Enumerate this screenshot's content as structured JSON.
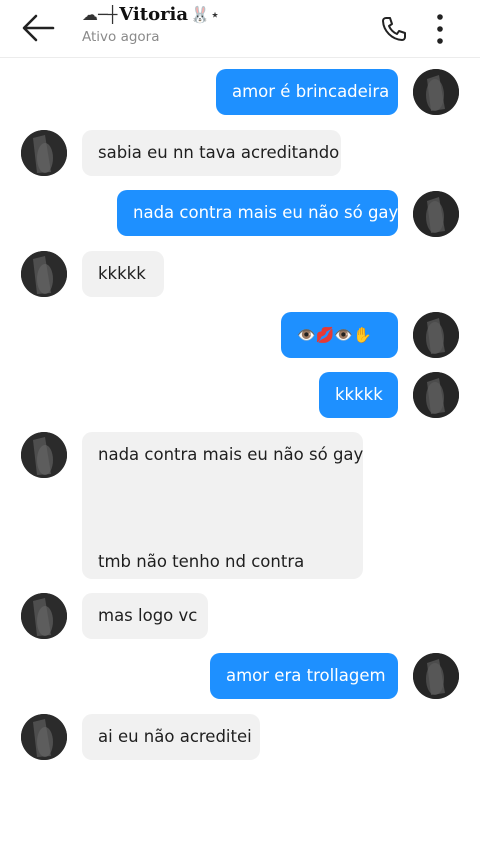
{
  "header": {
    "contact_name": "Vitoria",
    "status": "Ativo agora"
  },
  "messages": [
    {
      "from": "me",
      "text": "amor é brincadeira"
    },
    {
      "from": "them",
      "text": "sabia eu nn tava acreditando"
    },
    {
      "from": "me",
      "text": "nada contra mais eu não só gay"
    },
    {
      "from": "them",
      "text": "kkkkk"
    },
    {
      "from": "me",
      "text": "👁️💋👁️✋"
    },
    {
      "from": "me",
      "text": "kkkkk"
    },
    {
      "from": "them",
      "line1": "nada contra mais eu não só gay",
      "line2": "tmb não tenho nd contra"
    },
    {
      "from": "them",
      "text": "mas logo vc"
    },
    {
      "from": "me",
      "text": "amor era trollagem"
    },
    {
      "from": "them",
      "text": "ai eu não acreditei"
    }
  ],
  "colors": {
    "outgoing_bubble": "#1e90ff",
    "incoming_bubble": "#f1f1f1"
  },
  "icons": [
    "back-arrow-icon",
    "phone-icon",
    "more-vertical-icon"
  ]
}
